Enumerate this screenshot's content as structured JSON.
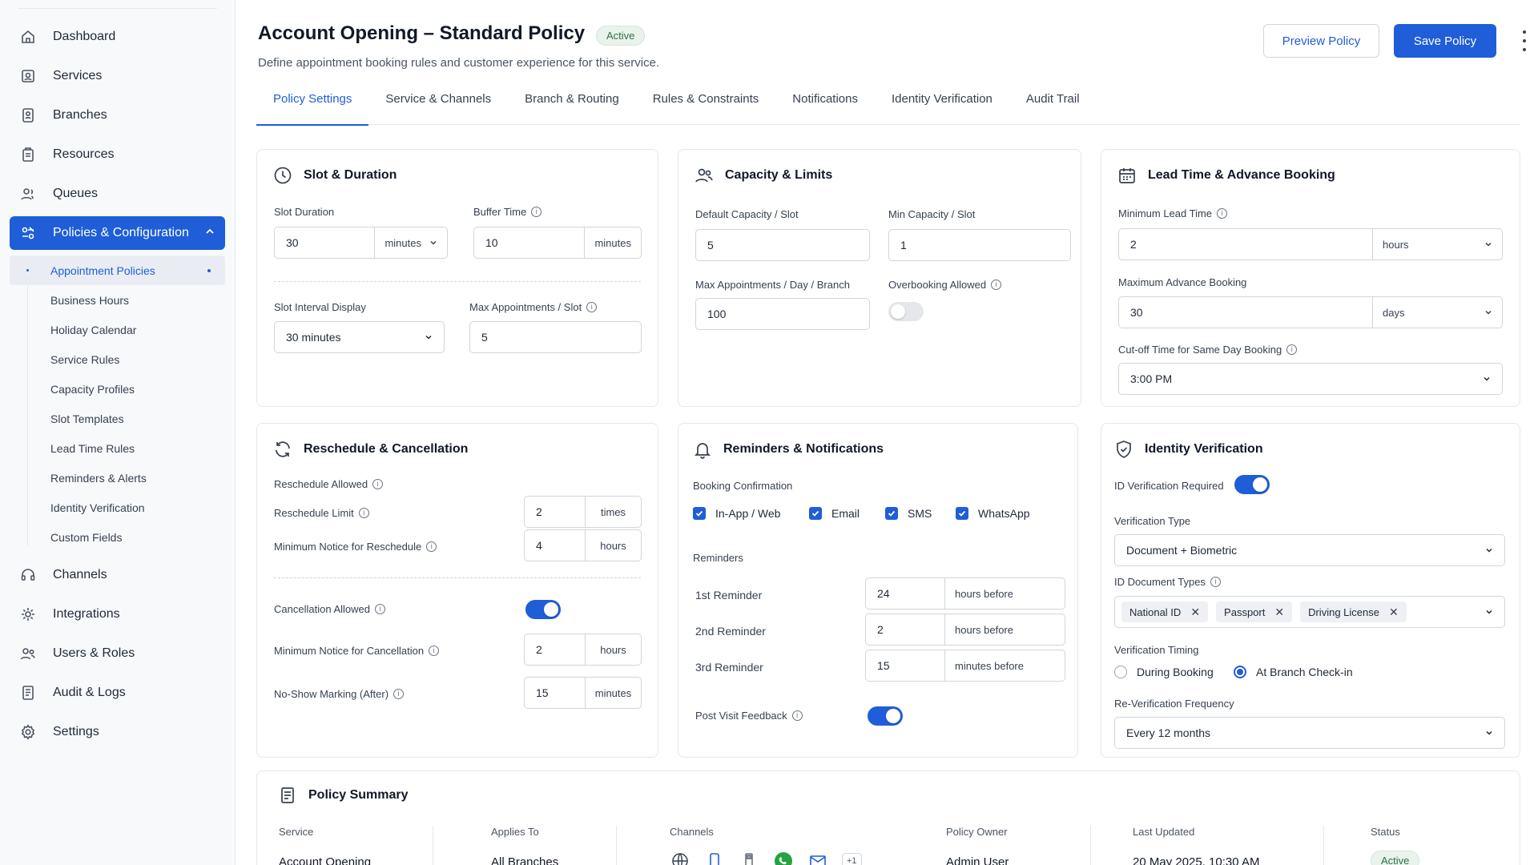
{
  "sidebar": {
    "items": [
      {
        "label": "Dashboard",
        "icon": "home-icon"
      },
      {
        "label": "Services",
        "icon": "services-icon"
      },
      {
        "label": "Branches",
        "icon": "branches-icon"
      },
      {
        "label": "Resources",
        "icon": "resources-icon"
      },
      {
        "label": "Queues",
        "icon": "queues-icon"
      },
      {
        "label": "Policies & Configuration",
        "icon": "policies-icon"
      },
      {
        "label": "Channels",
        "icon": "headset-icon"
      },
      {
        "label": "Integrations",
        "icon": "integrations-icon"
      },
      {
        "label": "Users & Roles",
        "icon": "users-icon"
      },
      {
        "label": "Audit & Logs",
        "icon": "audit-icon"
      },
      {
        "label": "Settings",
        "icon": "gear-icon"
      }
    ],
    "subitems": [
      "Appointment Policies",
      "Business Hours",
      "Holiday Calendar",
      "Service Rules",
      "Capacity Profiles",
      "Slot Templates",
      "Lead Time Rules",
      "Reminders & Alerts",
      "Identity Verification",
      "Custom Fields"
    ]
  },
  "header": {
    "title": "Account Opening – Standard Policy",
    "status": "Active",
    "subtitle": "Define appointment booking rules and customer experience for this service.",
    "preview_label": "Preview Policy",
    "save_label": "Save Policy"
  },
  "tabs": [
    "Policy Settings",
    "Service & Channels",
    "Branch & Routing",
    "Rules & Constraints",
    "Notifications",
    "Identity Verification",
    "Audit Trail"
  ],
  "slot": {
    "title": "Slot & Duration",
    "slot_duration_label": "Slot Duration",
    "slot_duration": "30",
    "slot_duration_unit": "minutes",
    "buffer_label": "Buffer Time",
    "buffer": "10",
    "buffer_unit": "minutes",
    "interval_label": "Slot Interval Display",
    "interval": "30 minutes",
    "max_per_slot_label": "Max Appointments / Slot",
    "max_per_slot": "5"
  },
  "capacity": {
    "title": "Capacity & Limits",
    "default_label": "Default Capacity / Slot",
    "default": "5",
    "min_label": "Min Capacity / Slot",
    "min": "1",
    "max_day_label": "Max Appointments / Day / Branch",
    "max_day": "100",
    "overbooking_label": "Overbooking Allowed",
    "overbooking_on": false
  },
  "lead": {
    "title": "Lead Time & Advance Booking",
    "min_lead_label": "Minimum Lead Time",
    "min_lead": "2",
    "min_lead_unit": "hours",
    "max_adv_label": "Maximum Advance Booking",
    "max_adv": "30",
    "max_adv_unit": "days",
    "cutoff_label": "Cut-off Time for Same Day Booking",
    "cutoff": "3:00 PM"
  },
  "reschedule": {
    "title": "Reschedule & Cancellation",
    "allowed_label": "Reschedule Allowed",
    "limit_label": "Reschedule Limit",
    "limit": "2",
    "limit_unit": "times",
    "notice_label": "Minimum Notice for Reschedule",
    "notice": "4",
    "notice_unit": "hours",
    "cancel_label": "Cancellation Allowed",
    "cancel_on": true,
    "cancel_notice_label": "Minimum Notice for Cancellation",
    "cancel_notice": "2",
    "cancel_notice_unit": "hours",
    "noshow_label": "No-Show Marking (After)",
    "noshow": "15",
    "noshow_unit": "minutes"
  },
  "reminders": {
    "title": "Reminders & Notifications",
    "confirm_label": "Booking Confirmation",
    "channels": [
      "In-App / Web",
      "Email",
      "SMS",
      "WhatsApp"
    ],
    "reminders_label": "Reminders",
    "rows": [
      {
        "label": "1st Reminder",
        "value": "24",
        "unit": "hours before"
      },
      {
        "label": "2nd Reminder",
        "value": "2",
        "unit": "hours before"
      },
      {
        "label": "3rd Reminder",
        "value": "15",
        "unit": "minutes before"
      }
    ],
    "feedback_label": "Post Visit Feedback",
    "feedback_on": true
  },
  "identity": {
    "title": "Identity Verification",
    "required_label": "ID Verification Required",
    "required_on": true,
    "type_label": "Verification Type",
    "type": "Document + Biometric",
    "doc_label": "ID Document Types",
    "docs": [
      "National ID",
      "Passport",
      "Driving License"
    ],
    "timing_label": "Verification Timing",
    "timing_options": [
      "During Booking",
      "At Branch Check-in"
    ],
    "timing_selected": "At Branch Check-in",
    "reverify_label": "Re-Verification Frequency",
    "reverify": "Every 12 months"
  },
  "summary": {
    "title": "Policy Summary",
    "service_h": "Service",
    "service": "Account Opening",
    "applies_h": "Applies To",
    "applies": "All Branches",
    "channels_h": "Channels",
    "channels_more": "+1",
    "owner_h": "Policy Owner",
    "owner": "Admin User",
    "updated_h": "Last Updated",
    "updated": "20 May 2025, 10:30 AM",
    "status_h": "Status",
    "status": "Active"
  },
  "colors": {
    "accent": "#1f5ed8",
    "active_badge_bg": "#e9f3ec",
    "whatsapp": "#25a244"
  }
}
